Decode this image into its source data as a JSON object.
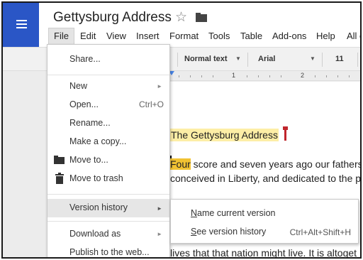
{
  "document": {
    "title": "Gettysburg Address"
  },
  "menubar": {
    "items": [
      "File",
      "Edit",
      "View",
      "Insert",
      "Format",
      "Tools",
      "Table",
      "Add-ons",
      "Help",
      "All c"
    ]
  },
  "toolbar": {
    "style": "Normal text",
    "font": "Arial",
    "size": "11"
  },
  "ruler": {
    "marks": [
      "1",
      "2"
    ]
  },
  "page": {
    "heading": "The Gettysburg Address",
    "para_line1_highlight": "Four",
    "para_line1_rest": " score and seven years ago our fathers",
    "para_line2": "conceived in Liberty, and dedicated to the p",
    "partial_line": "lives that that nation might live. It is altoget"
  },
  "file_menu": {
    "share": "Share...",
    "new": "New",
    "open": "Open...",
    "open_shortcut": "Ctrl+O",
    "rename": "Rename...",
    "copy": "Make a copy...",
    "move": "Move to...",
    "trash": "Move to trash",
    "version_history": "Version history",
    "download": "Download as",
    "publish": "Publish to the web..."
  },
  "version_submenu": {
    "name_current_first": "N",
    "name_current_rest": "ame current version",
    "see_history_first": "S",
    "see_history_rest": "ee version history",
    "see_history_shortcut": "Ctrl+Alt+Shift+H"
  },
  "icons": {
    "app": "docs-menu-icon",
    "star": "star-icon",
    "folder": "folder-icon",
    "trash": "trash-icon",
    "submenu": "submenu-arrow-icon"
  },
  "colors": {
    "app_blue": "#2a56c6",
    "heading_highlight": "#fdeea6",
    "word_highlight": "#f1c232",
    "collaborator_cursor": "#c0262d"
  }
}
